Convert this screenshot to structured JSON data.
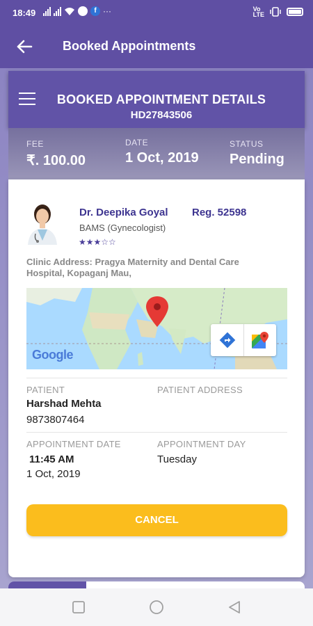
{
  "status_bar": {
    "time": "18:49",
    "right_small_text": "Vo\nLTE"
  },
  "app_bar": {
    "title": "Booked Appointments",
    "back_icon": "arrow-left-icon"
  },
  "card": {
    "title": "BOOKED APPOINTMENT DETAILS",
    "booking_id": "HD27843506",
    "menu_icon": "hamburger-menu-icon"
  },
  "summary": {
    "fee_label": "FEE",
    "fee_value": "₹. 100.00",
    "date_label": "DATE",
    "date_value": "1 Oct, 2019",
    "status_label": "STATUS",
    "status_value": "Pending"
  },
  "doctor": {
    "name": "Dr. Deepika Goyal",
    "reg": "Reg. 52598",
    "qualification": "BAMS (Gynecologist)",
    "rating_stars": "★★★☆☆",
    "rating_value": 3.5
  },
  "clinic": {
    "address": "Clinic Address: Pragya Maternity and Dental Care Hospital, Kopaganj Mau,"
  },
  "map": {
    "logo_text": "Google",
    "directions_icon": "directions-icon",
    "open_maps_icon": "google-maps-icon",
    "pin_icon": "map-pin-icon"
  },
  "patient": {
    "name_label": "PATIENT",
    "name": "Harshad Mehta",
    "phone": "9873807464",
    "address_label": "PATIENT ADDRESS",
    "address": ""
  },
  "appointment": {
    "date_label": "APPOINTMENT DATE",
    "time": "11:45 AM",
    "date": "1 Oct, 2019",
    "day_label": "APPOINTMENT DAY",
    "day": "Tuesday"
  },
  "actions": {
    "cancel_label": "CANCEL"
  },
  "nav_bar": {
    "recents_icon": "square-icon",
    "home_icon": "circle-icon",
    "back_icon": "triangle-back-icon"
  },
  "colors": {
    "primary": "#5f4fa3",
    "accent": "#fbbd1d",
    "doctor_text": "#3d3490"
  }
}
